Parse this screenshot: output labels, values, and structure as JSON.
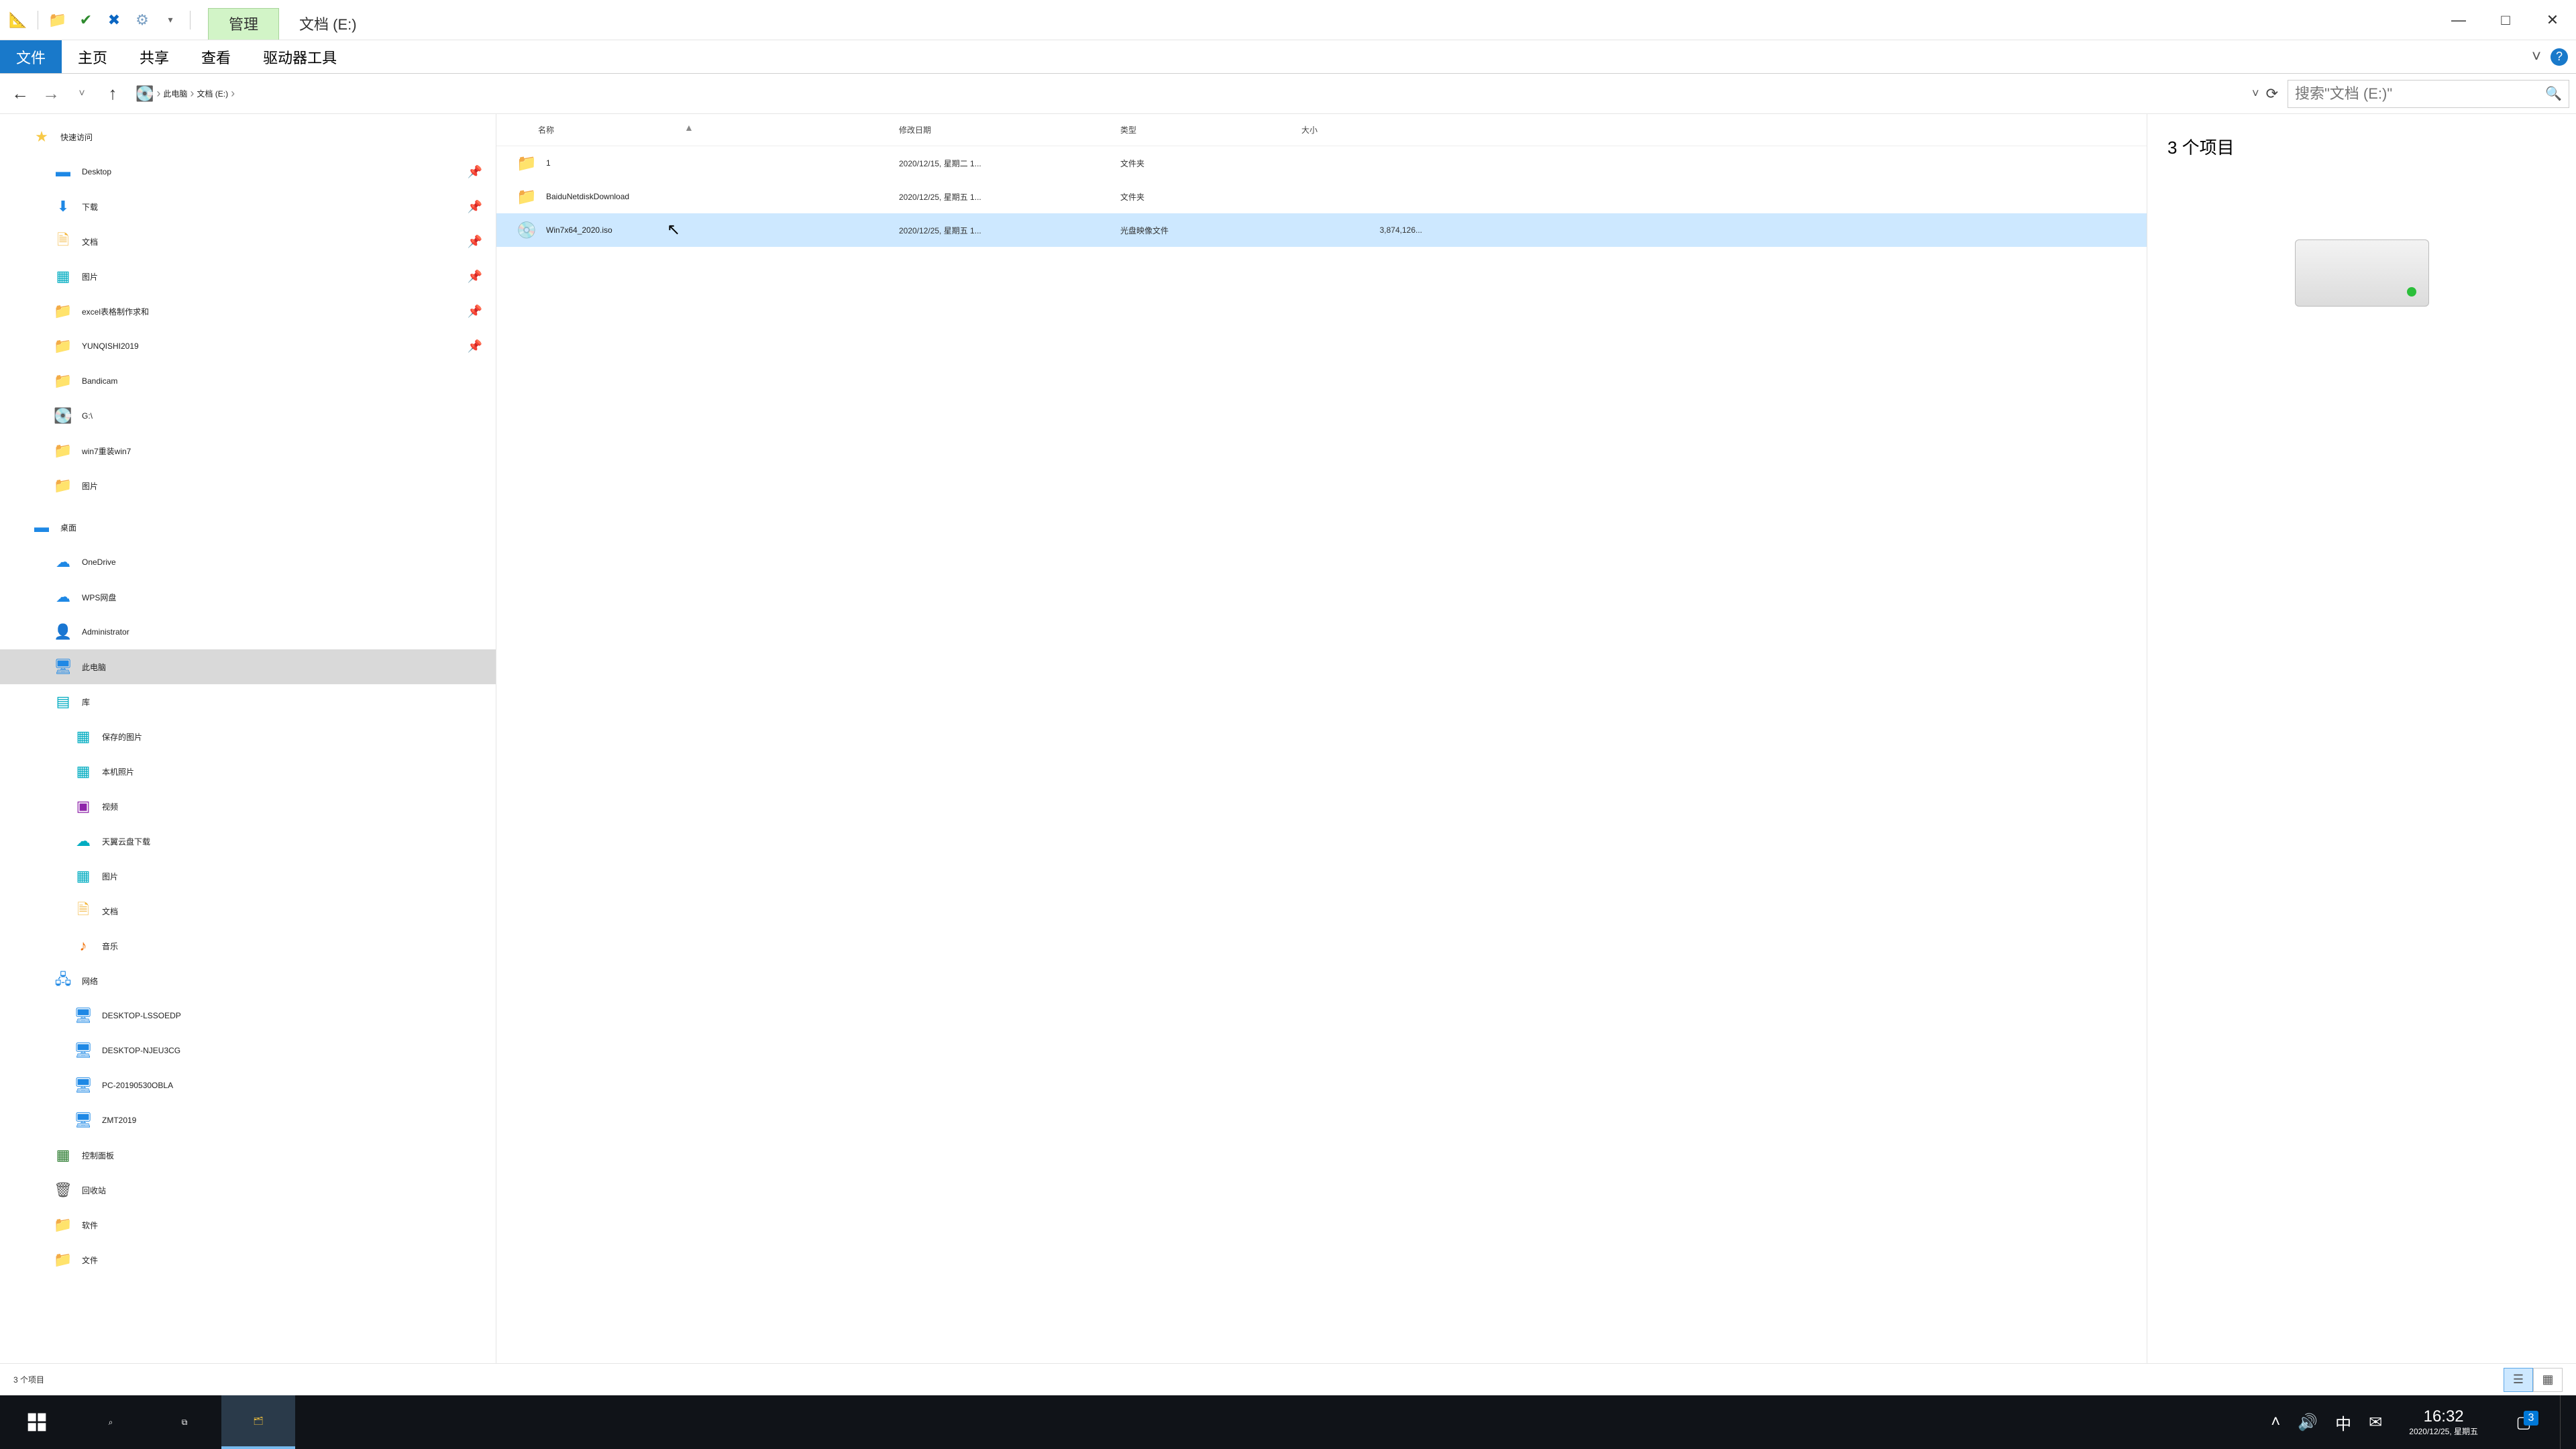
{
  "titlebar": {
    "manage_tab": "管理",
    "location_title": "文档 (E:)"
  },
  "ribbon": {
    "file": "文件",
    "home": "主页",
    "share": "共享",
    "view": "查看",
    "drive_tools": "驱动器工具"
  },
  "address": {
    "root": "此电脑",
    "loc": "文档 (E:)"
  },
  "search": {
    "placeholder": "搜索\"文档 (E:)\""
  },
  "tree": {
    "quick": "快速访问",
    "quick_items": [
      {
        "label": "Desktop"
      },
      {
        "label": "下载"
      },
      {
        "label": "文档"
      },
      {
        "label": "图片"
      },
      {
        "label": "excel表格制作求和"
      },
      {
        "label": "YUNQISHI2019"
      },
      {
        "label": "Bandicam"
      },
      {
        "label": "G:\\"
      },
      {
        "label": "win7重装win7"
      },
      {
        "label": "图片"
      }
    ],
    "desktop": "桌面",
    "onedrive": "OneDrive",
    "wps": "WPS网盘",
    "admin": "Administrator",
    "thispc": "此电脑",
    "lib": "库",
    "lib_items": [
      {
        "label": "保存的图片"
      },
      {
        "label": "本机照片"
      },
      {
        "label": "视频"
      },
      {
        "label": "天翼云盘下载"
      },
      {
        "label": "图片"
      },
      {
        "label": "文档"
      },
      {
        "label": "音乐"
      }
    ],
    "network": "网络",
    "net_items": [
      {
        "label": "DESKTOP-LSSOEDP"
      },
      {
        "label": "DESKTOP-NJEU3CG"
      },
      {
        "label": "PC-20190530OBLA"
      },
      {
        "label": "ZMT2019"
      }
    ],
    "cpl": "控制面板",
    "recycle": "回收站",
    "soft": "软件",
    "files": "文件"
  },
  "columns": {
    "name": "名称",
    "date": "修改日期",
    "type": "类型",
    "size": "大小"
  },
  "rows": [
    {
      "name": "1",
      "date": "2020/12/15, 星期二 1...",
      "type": "文件夹",
      "size": "",
      "icon": "fold"
    },
    {
      "name": "BaiduNetdiskDownload",
      "date": "2020/12/25, 星期五 1...",
      "type": "文件夹",
      "size": "",
      "icon": "fold"
    },
    {
      "name": "Win7x64_2020.iso",
      "date": "2020/12/25, 星期五 1...",
      "type": "光盘映像文件",
      "size": "3,874,126...",
      "icon": "iso"
    }
  ],
  "preview": {
    "title": "3 个项目"
  },
  "status": {
    "text": "3 个项目"
  },
  "tray": {
    "ime": "中",
    "time": "16:32",
    "date": "2020/12/25, 星期五",
    "notif_count": "3"
  }
}
